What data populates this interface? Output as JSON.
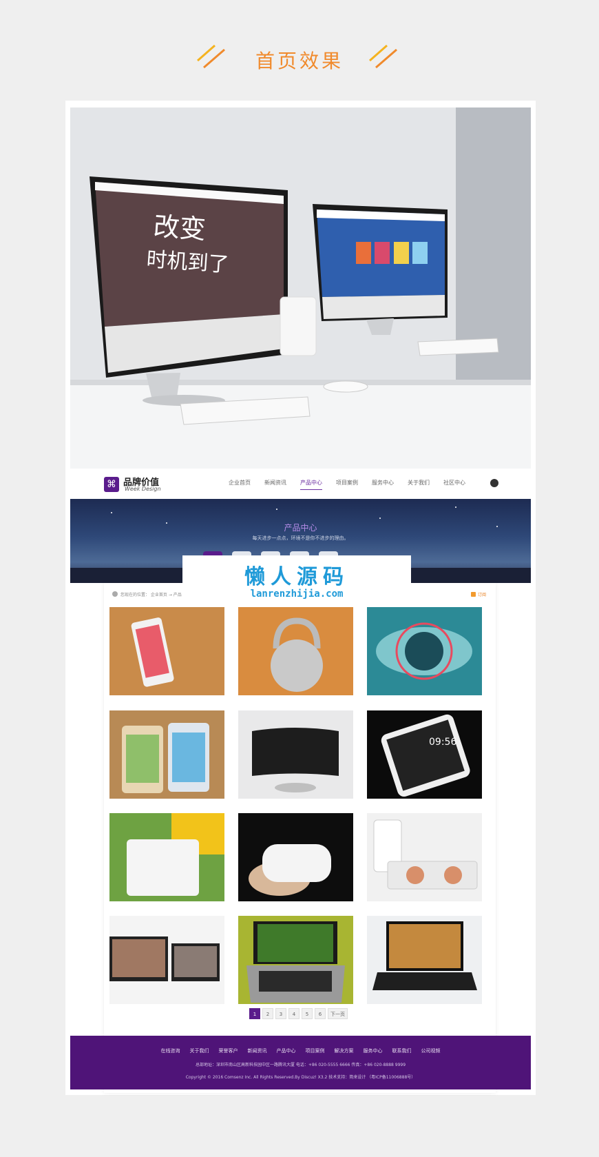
{
  "header": {
    "title": "首页效果",
    "accent_color": "#f08a2c"
  },
  "nav": {
    "logo_cn": "品牌价值",
    "logo_en": "Week Design",
    "menu": [
      "企业首页",
      "新闻资讯",
      "产品中心",
      "项目案例",
      "服务中心",
      "关于我们",
      "社区中心"
    ],
    "active_index": 2
  },
  "banner": {
    "title": "产品中心",
    "subtitle": "每天进步一点点，环境不是你不进步的理由。"
  },
  "watermark": {
    "cn": "懒人源码",
    "en": "lanrenzhijia.com",
    "color": "#1f9ad8"
  },
  "content": {
    "breadcrumb": "您现在的位置： 企业首页 → 产品",
    "rss_label": "订阅",
    "products": [
      {
        "name": "phone-on-wood"
      },
      {
        "name": "smart-padlock"
      },
      {
        "name": "eye-scan"
      },
      {
        "name": "two-phones"
      },
      {
        "name": "curved-monitor"
      },
      {
        "name": "black-phone"
      },
      {
        "name": "white-router"
      },
      {
        "name": "pocket-wifi"
      },
      {
        "name": "phone-speaker"
      },
      {
        "name": "laptops-movie"
      },
      {
        "name": "laptop-green"
      },
      {
        "name": "laptop-game"
      }
    ],
    "pager": [
      "1",
      "2",
      "3",
      "4",
      "5",
      "6",
      "下一页"
    ]
  },
  "footer": {
    "links": [
      "在线咨询",
      "关于我们",
      "荣誉客户",
      "新闻资讯",
      "产品中心",
      "项目案例",
      "解决方案",
      "服务中心",
      "联系我们",
      "公司视频"
    ],
    "address": "总部地址：深圳市南山区高新科技园中区一路腾讯大厦  电话：+86 020-5555 6666  传真：+86 020-8888 9999",
    "copyright": "Copyright © 2016  Comsenz Inc.  All Rights Reserved.By  Discuz!  X3.2  技术支持：简来设计  （粤ICP备11006888号）",
    "bg_color": "#4f1478"
  }
}
